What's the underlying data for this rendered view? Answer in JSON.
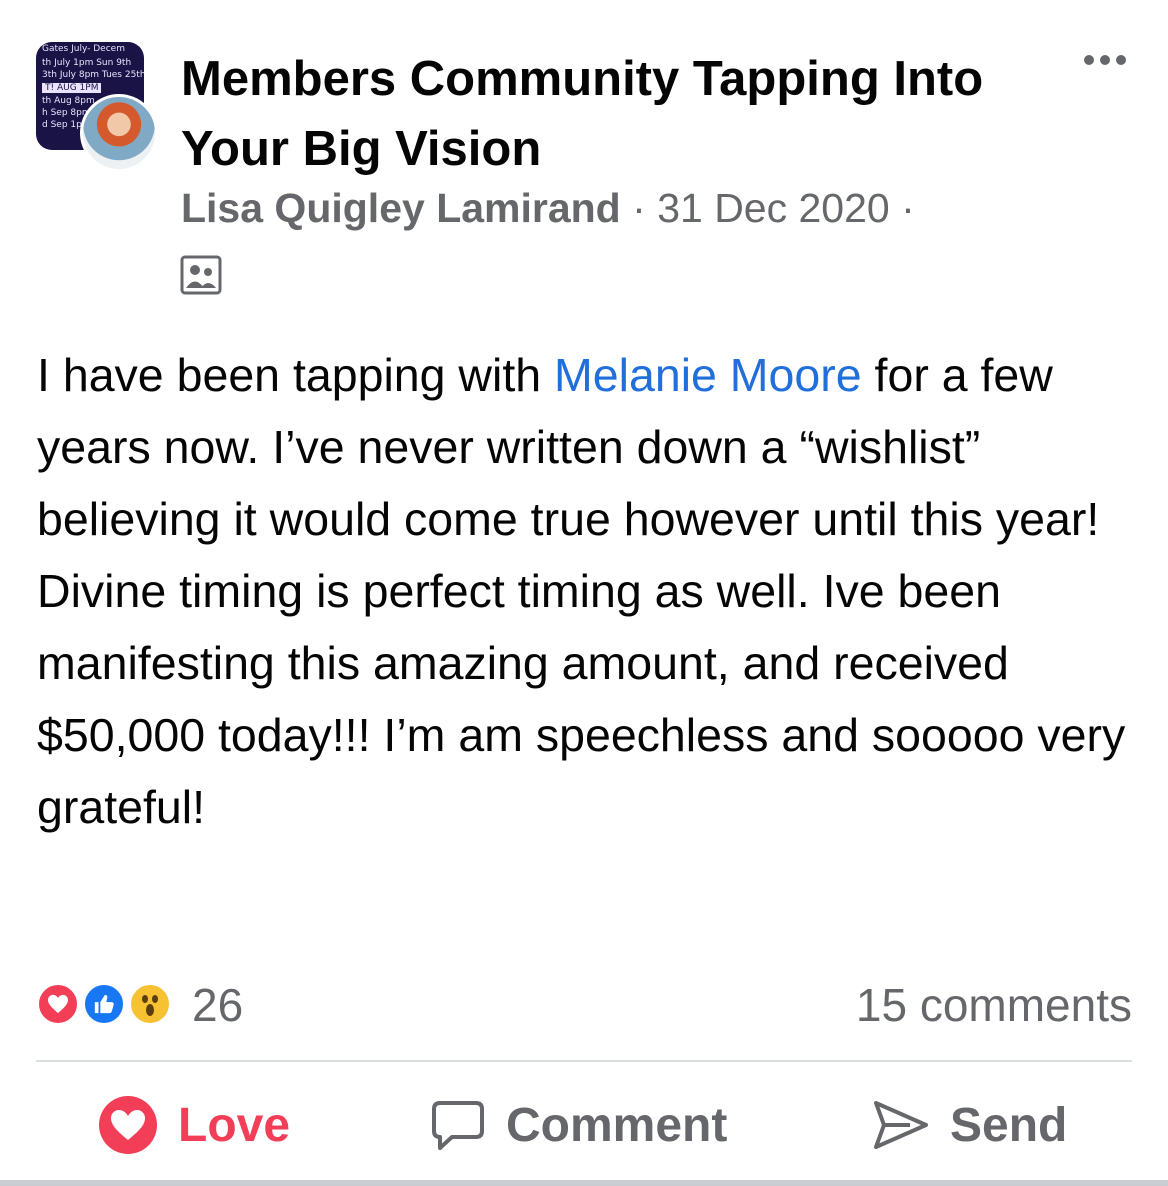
{
  "post": {
    "group_name": "Members Community Tapping Into Your Big Vision",
    "author": "Lisa Quigley Lamirand",
    "separator": "·",
    "date": "31 Dec 2020",
    "group_thumbnail_text": [
      "Gates July- Decem",
      "th July 1pm     Sun 9th",
      "3th July 8pm   Tues 25th",
      "T! AUG 1PM",
      "th Aug 8pm",
      "h Sep 8pm",
      "d Sep 1pm"
    ],
    "body": {
      "before_mention": "I have been tapping with ",
      "mention": "Melanie Moore",
      "after_mention": " for a few years now. I’ve never written down a “wishlist” believing it would come true however until this year! Divine timing is perfect timing as well. Ive been manifesting this amazing amount, and received $50,000 today!!!  I’m am speechless and sooooo very grateful!"
    }
  },
  "reactions": {
    "count": "26",
    "types": [
      "love-icon",
      "like-icon",
      "wow-icon"
    ]
  },
  "comments_label": "15 comments",
  "actions": {
    "love": "Love",
    "comment": "Comment",
    "send": "Send"
  },
  "colors": {
    "love": "#f33e58",
    "like": "#1877f2",
    "wow": "#f7c232",
    "mention": "#216fdb",
    "secondary_text": "#65676b"
  }
}
